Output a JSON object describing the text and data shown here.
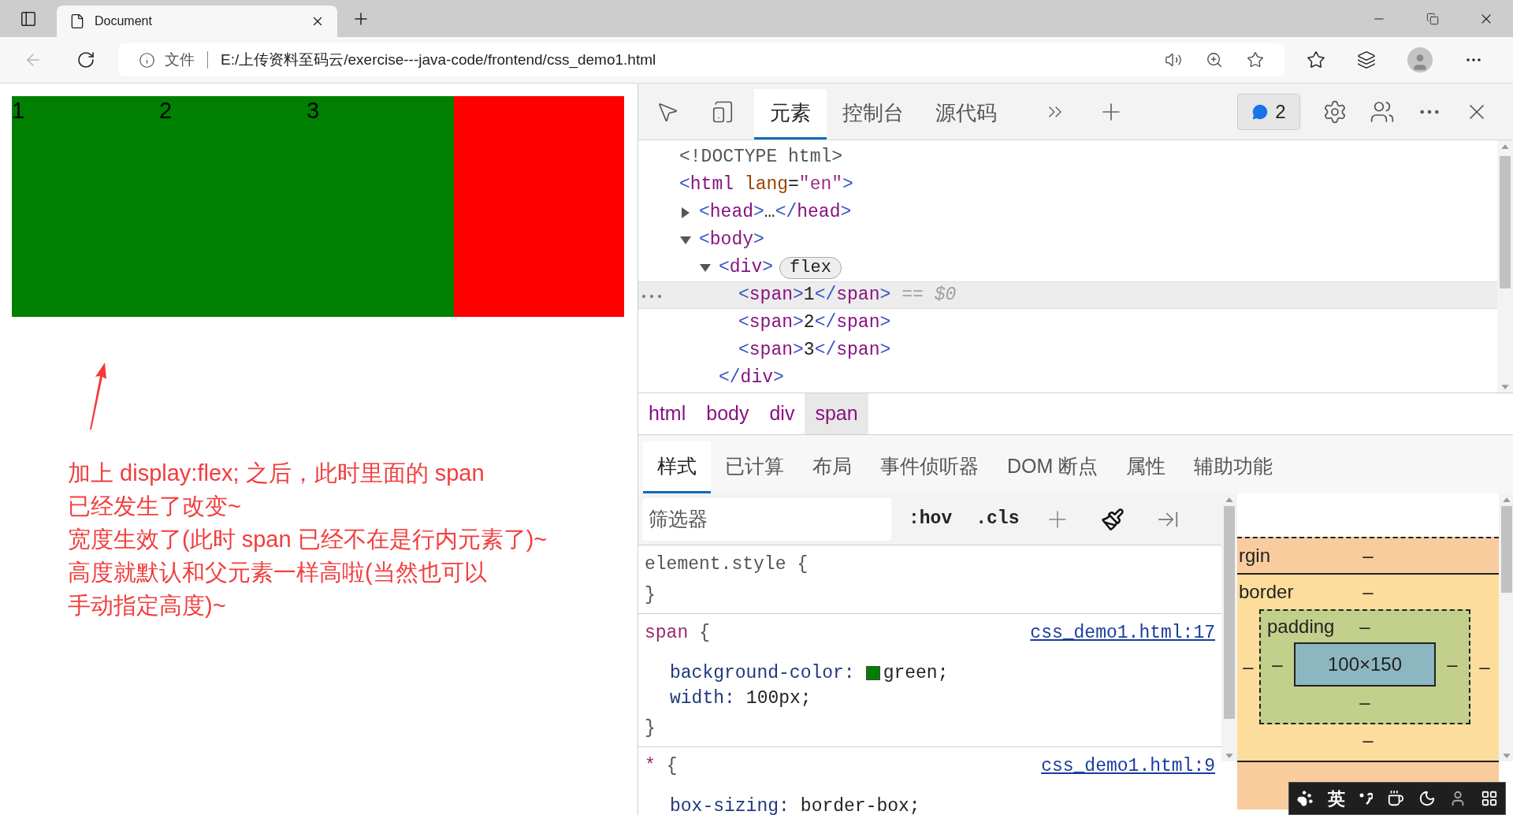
{
  "browser": {
    "tab_title": "Document",
    "back_disabled": true,
    "address_label": "文件",
    "url": "E:/上传资料至码云/exercise---java-code/frontend/css_demo1.html"
  },
  "page": {
    "demo_items": [
      {
        "text": "1"
      },
      {
        "text": "2"
      },
      {
        "text": "3"
      }
    ],
    "annotation": [
      "加上 display:flex; 之后，此时里面的 span",
      "已经发生了改变~",
      "宽度生效了(此时 span 已经不在是行内元素了)~",
      "高度就默认和父元素一样高啦(当然也可以",
      "手动指定高度)~"
    ]
  },
  "devtools": {
    "panel_tabs": [
      {
        "label": "元素",
        "selected": true
      },
      {
        "label": "控制台",
        "selected": false
      },
      {
        "label": "源代码",
        "selected": false
      }
    ],
    "issues_count": "2",
    "dom_tree": [
      {
        "selected": false,
        "tokens": [
          {
            "text": "<!DOCTYPE html>",
            "kind": "doctype"
          }
        ]
      },
      {
        "selected": false,
        "tokens": [
          {
            "text": "<",
            "kind": "bracket"
          },
          {
            "text": "html",
            "kind": "tag"
          },
          {
            "text": " lang",
            "kind": "attr"
          },
          {
            "text": "=",
            "kind": "plain"
          },
          {
            "text": "\"en\"",
            "kind": "value"
          },
          {
            "text": ">",
            "kind": "bracket"
          }
        ],
        "children": [
          {
            "selected": false,
            "expanded": false,
            "tokens": [
              {
                "text": "<",
                "kind": "bracket"
              },
              {
                "text": "head",
                "kind": "tag"
              },
              {
                "text": ">",
                "kind": "bracket"
              },
              {
                "text": "…",
                "kind": "plain"
              },
              {
                "text": "</",
                "kind": "bracket"
              },
              {
                "text": "head",
                "kind": "tag"
              },
              {
                "text": ">",
                "kind": "bracket"
              }
            ]
          },
          {
            "selected": false,
            "expanded": true,
            "tokens": [
              {
                "text": "<",
                "kind": "bracket"
              },
              {
                "text": "body",
                "kind": "tag"
              },
              {
                "text": ">",
                "kind": "bracket"
              }
            ],
            "children": [
              {
                "selected": false,
                "expanded": true,
                "badge": "flex",
                "tokens": [
                  {
                    "text": "<",
                    "kind": "bracket"
                  },
                  {
                    "text": "div",
                    "kind": "tag"
                  },
                  {
                    "text": ">",
                    "kind": "bracket"
                  }
                ],
                "children": [
                  {
                    "selected": true,
                    "marker": "== $0",
                    "tokens": [
                      {
                        "text": "<",
                        "kind": "bracket"
                      },
                      {
                        "text": "span",
                        "kind": "tag"
                      },
                      {
                        "text": ">",
                        "kind": "bracket"
                      },
                      {
                        "text": "1",
                        "kind": "plain"
                      },
                      {
                        "text": "</",
                        "kind": "bracket"
                      },
                      {
                        "text": "span",
                        "kind": "tag"
                      },
                      {
                        "text": ">",
                        "kind": "bracket"
                      }
                    ]
                  },
                  {
                    "selected": false,
                    "tokens": [
                      {
                        "text": "<",
                        "kind": "bracket"
                      },
                      {
                        "text": "span",
                        "kind": "tag"
                      },
                      {
                        "text": ">",
                        "kind": "bracket"
                      },
                      {
                        "text": "2",
                        "kind": "plain"
                      },
                      {
                        "text": "</",
                        "kind": "bracket"
                      },
                      {
                        "text": "span",
                        "kind": "tag"
                      },
                      {
                        "text": ">",
                        "kind": "bracket"
                      }
                    ]
                  },
                  {
                    "selected": false,
                    "tokens": [
                      {
                        "text": "<",
                        "kind": "bracket"
                      },
                      {
                        "text": "span",
                        "kind": "tag"
                      },
                      {
                        "text": ">",
                        "kind": "bracket"
                      },
                      {
                        "text": "3",
                        "kind": "plain"
                      },
                      {
                        "text": "</",
                        "kind": "bracket"
                      },
                      {
                        "text": "span",
                        "kind": "tag"
                      },
                      {
                        "text": ">",
                        "kind": "bracket"
                      }
                    ]
                  }
                ],
                "closing": [
                  {
                    "text": "</",
                    "kind": "bracket"
                  },
                  {
                    "text": "div",
                    "kind": "tag"
                  },
                  {
                    "text": ">",
                    "kind": "bracket"
                  }
                ]
              }
            ]
          }
        ]
      }
    ],
    "breadcrumbs": [
      {
        "label": "html",
        "selected": false
      },
      {
        "label": "body",
        "selected": false
      },
      {
        "label": "div",
        "selected": false
      },
      {
        "label": "span",
        "selected": true
      }
    ],
    "sidebar_tabs": [
      {
        "label": "样式",
        "selected": true
      },
      {
        "label": "已计算",
        "selected": false
      },
      {
        "label": "布局",
        "selected": false
      },
      {
        "label": "事件侦听器",
        "selected": false
      },
      {
        "label": "DOM 断点",
        "selected": false
      },
      {
        "label": "属性",
        "selected": false
      },
      {
        "label": "辅助功能",
        "selected": false
      }
    ],
    "filter": {
      "placeholder": "筛选器"
    },
    "toolbar_buttons": [
      ":hov",
      ".cls"
    ],
    "rules": [
      {
        "kind": "inline",
        "selector": "element.style",
        "open": "{",
        "close": "}"
      },
      {
        "kind": "selector",
        "selector": "span",
        "open": "{",
        "source": "css_demo1.html:17",
        "declarations": [
          {
            "name": "background-color:",
            "value": "green;",
            "swatch": true
          },
          {
            "name": "width:",
            "value": "100px;"
          }
        ],
        "close": "}"
      },
      {
        "kind": "selector",
        "selector": "*",
        "open": "{",
        "source": "css_demo1.html:9",
        "declarations": [
          {
            "name": "box-sizing:",
            "value": "border-box;"
          }
        ]
      }
    ],
    "box_model": {
      "margin": {
        "label": "rgin",
        "top": "–"
      },
      "border": {
        "label": "border",
        "top": "–",
        "left": "–",
        "right": "–",
        "bottom": "–"
      },
      "padding": {
        "label": "padding",
        "top": "–",
        "left": "–",
        "right": "–",
        "bottom": "–"
      },
      "content": "100×150"
    }
  },
  "ime_toolbar": {
    "label": "英"
  }
}
